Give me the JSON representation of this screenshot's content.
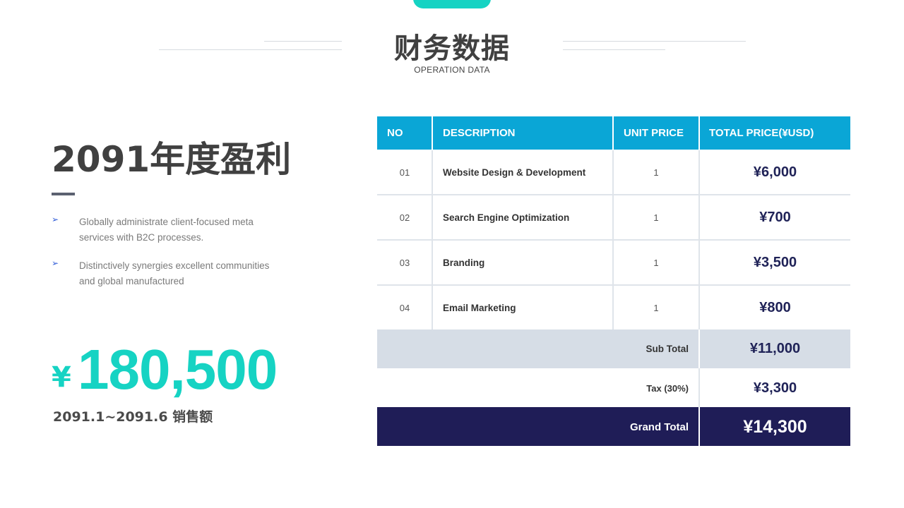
{
  "header": {
    "title": "财务数据",
    "subtitle": "OPERATION DATA"
  },
  "left": {
    "year_title": "2091年度盈利",
    "bullets": [
      "Globally administrate client-focused meta services with B2C processes.",
      "Distinctively synergies excellent communities and global manufactured"
    ],
    "currency": "¥",
    "amount": "180,500",
    "caption": "2091.1~2091.6 销售额"
  },
  "table": {
    "headers": {
      "no": "NO",
      "description": "DESCRIPTION",
      "unit_price": "UNIT PRICE",
      "total_price": "TOTAL PRICE(¥USD)"
    },
    "rows": [
      {
        "no": "01",
        "description": "Website Design & Development",
        "unit_price": "1",
        "total": "¥6,000"
      },
      {
        "no": "02",
        "description": "Search Engine Optimization",
        "unit_price": "1",
        "total": "¥700"
      },
      {
        "no": "03",
        "description": "Branding",
        "unit_price": "1",
        "total": "¥3,500"
      },
      {
        "no": "04",
        "description": "Email Marketing",
        "unit_price": "1",
        "total": "¥800"
      }
    ],
    "subtotal": {
      "label": "Sub Total",
      "value": "¥11,000"
    },
    "tax": {
      "label": "Tax (30%)",
      "value": "¥3,300"
    },
    "grand_total": {
      "label": "Grand Total",
      "value": "¥14,300"
    }
  },
  "colors": {
    "accent_teal": "#16d3c3",
    "header_blue": "#0aa6d6",
    "navy": "#1f1d57",
    "subtotal_bg": "#d6dde6"
  }
}
